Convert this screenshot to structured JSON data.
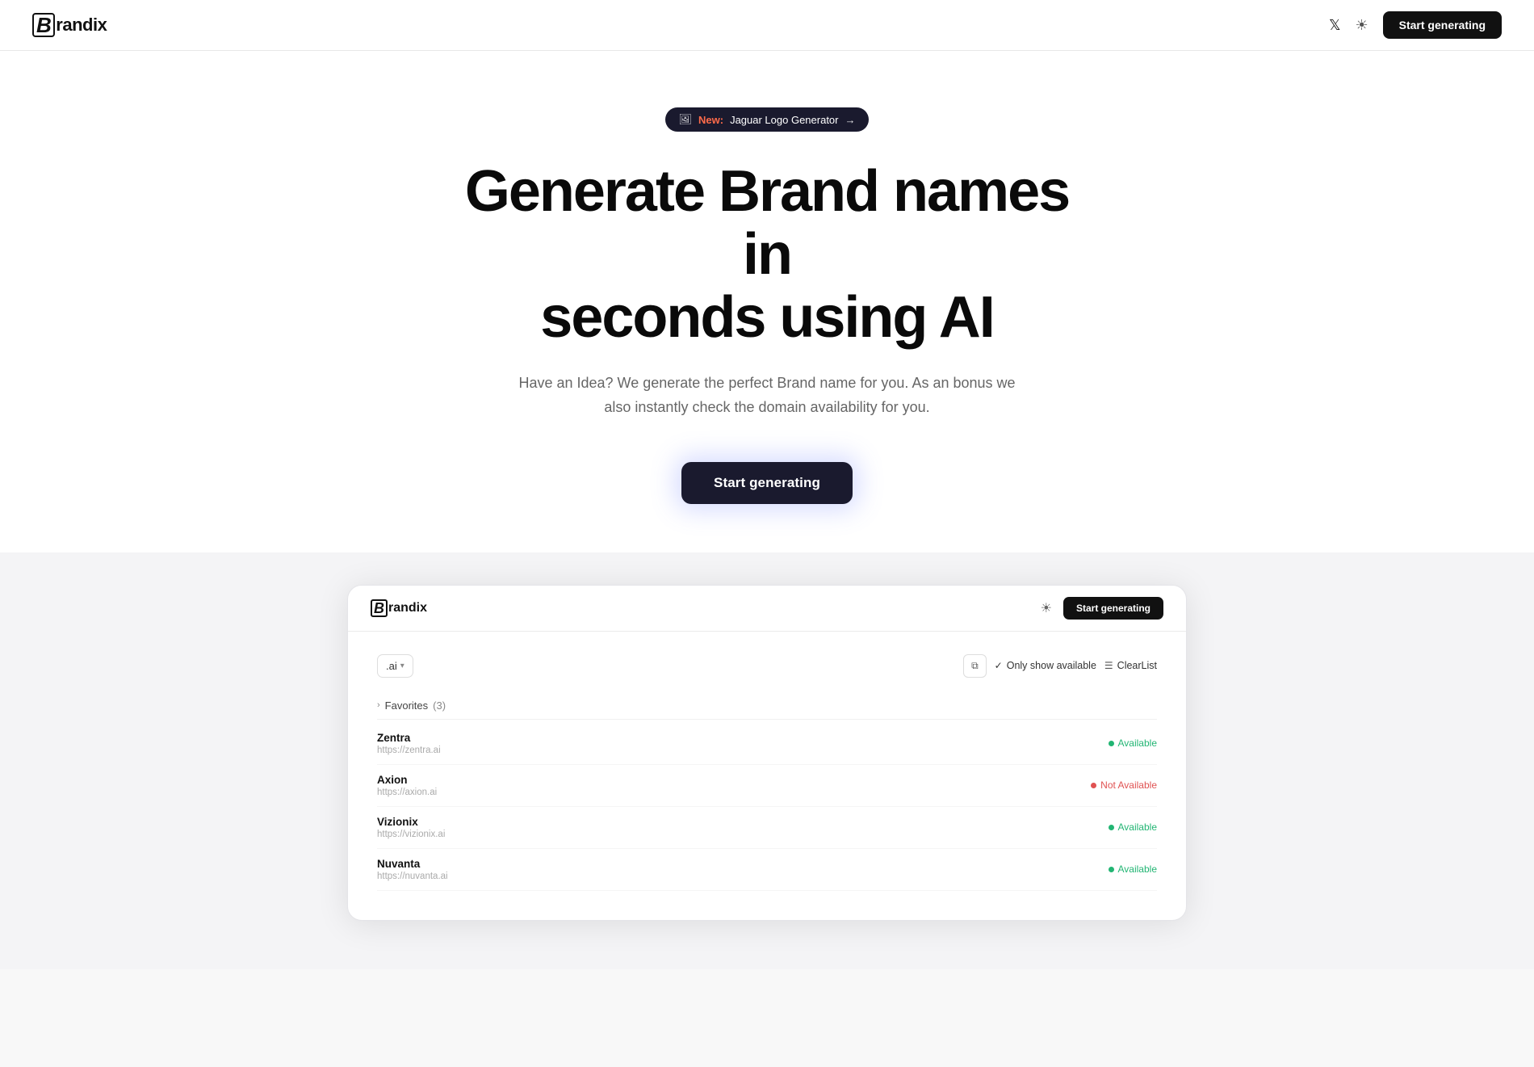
{
  "nav": {
    "logo_b": "B",
    "logo_text": "randix",
    "twitter_icon": "𝕏",
    "theme_icon": "☀",
    "start_btn": "Start generating"
  },
  "hero": {
    "badge": {
      "icon": "🖼",
      "new_text": "New:",
      "link_text": "Jaguar Logo Generator",
      "arrow": "→"
    },
    "title_line1": "Generate Brand names in",
    "title_line2": "seconds using AI",
    "subtitle": "Have an Idea? We generate the perfect Brand name for you. As an bonus we also instantly check the domain availability for you.",
    "cta_label": "Start generating"
  },
  "demo": {
    "nav": {
      "logo_b": "B",
      "logo_text": "randix",
      "theme_icon": "☀",
      "start_btn": "Start generating"
    },
    "toolbar": {
      "extension": ".ai",
      "copy_icon": "⧉",
      "show_available_label": "Only show available",
      "clearlist_label": "ClearList"
    },
    "favorites": {
      "label": "Favorites",
      "count": "(3)"
    },
    "brands": [
      {
        "name": "Zentra",
        "url": "https://zentra.ai",
        "status": "Available",
        "available": true
      },
      {
        "name": "Axion",
        "url": "https://axion.ai",
        "status": "Not Available",
        "available": false
      },
      {
        "name": "Vizionix",
        "url": "https://vizionix.ai",
        "status": "Available",
        "available": true
      },
      {
        "name": "Nuvanta",
        "url": "https://nuvanta.ai",
        "status": "Available",
        "available": true
      }
    ]
  }
}
